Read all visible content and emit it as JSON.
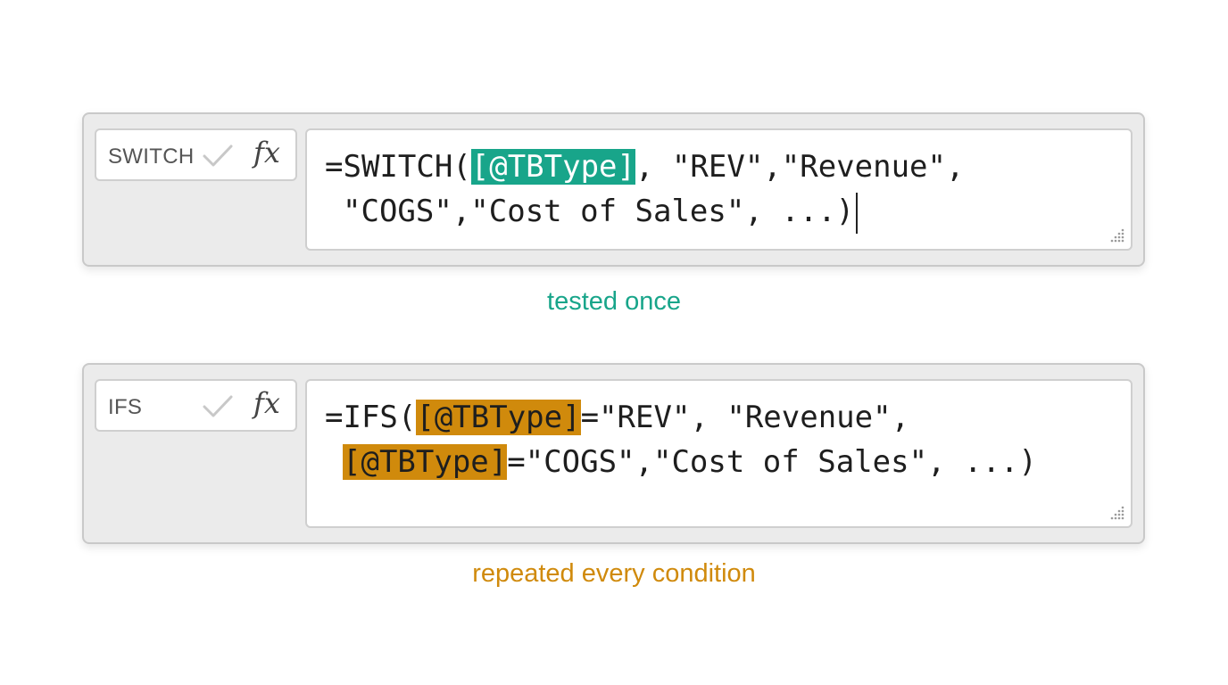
{
  "colors": {
    "switch_accent": "#18a58a",
    "ifs_accent": "#d08a0c",
    "panel_bg": "#ebebeb"
  },
  "switch_example": {
    "name_box": "SWITCH",
    "check_icon": "checkmark-icon",
    "fx_label": "fx",
    "formula": {
      "prefix": "=SWITCH(",
      "reference": "[@TBType]",
      "rest_line1": ", \"REV\",\"Revenue\",",
      "line2": "\"COGS\",\"Cost of Sales\", ...)"
    },
    "caption": "tested once"
  },
  "ifs_example": {
    "name_box": "IFS",
    "check_icon": "checkmark-icon",
    "fx_label": "fx",
    "formula": {
      "prefix": "=IFS(",
      "reference_1": "[@TBType]",
      "rest_line1": "=\"REV\", \"Revenue\",",
      "reference_2": "[@TBType]",
      "rest_line2": "=\"COGS\",\"Cost of Sales\", ...)"
    },
    "caption": "repeated every condition"
  }
}
